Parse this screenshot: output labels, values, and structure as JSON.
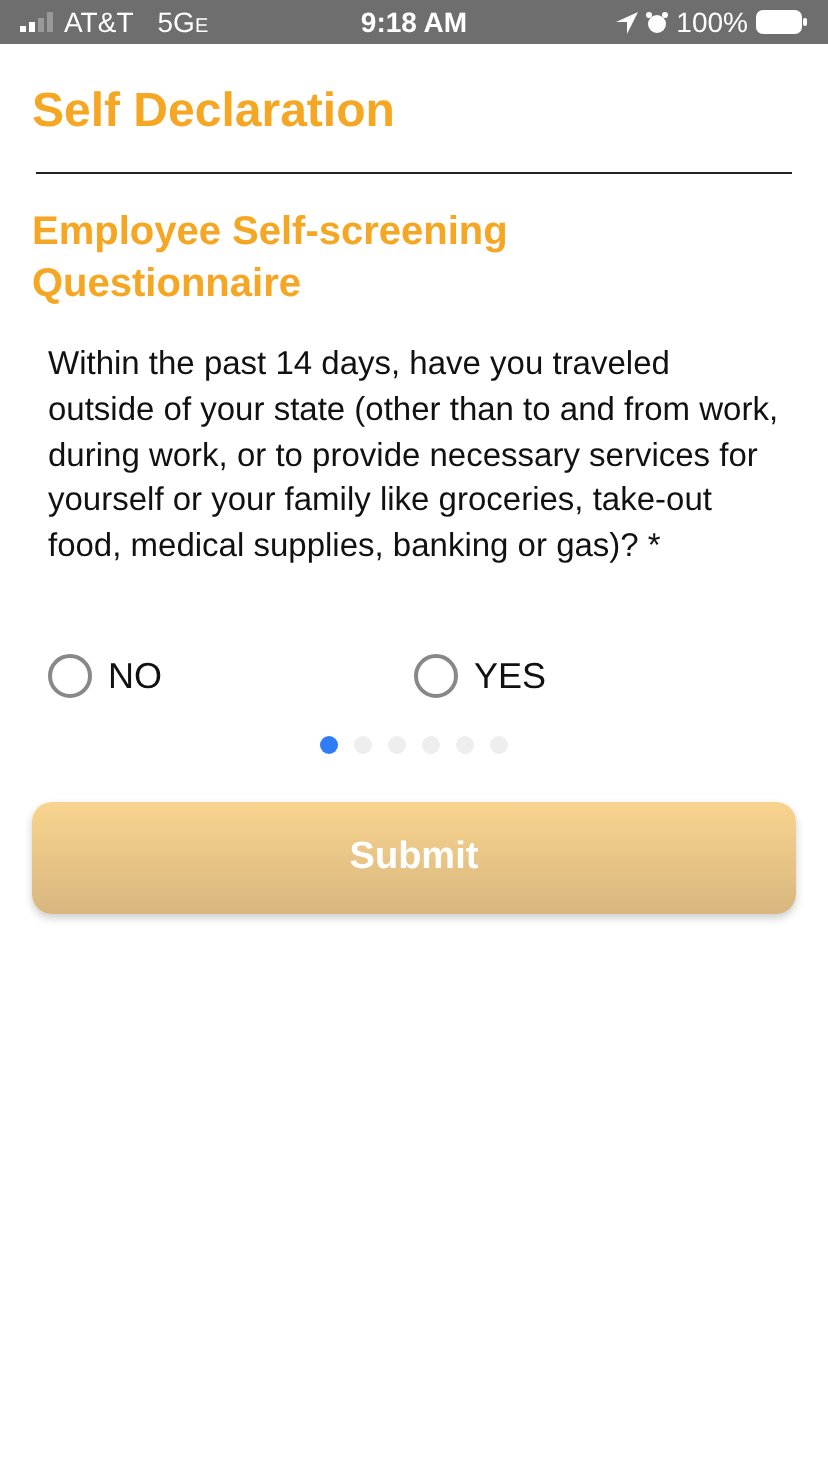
{
  "status_bar": {
    "carrier": "AT&T",
    "network": "5G",
    "network_suffix": "E",
    "time": "9:18 AM",
    "battery": "100%"
  },
  "title": "Self Declaration",
  "subtitle": "Employee Self-screening Questionnaire",
  "question": "Within the past 14 days, have you traveled outside of your state (other than to and from work, during work, or to provide necessary services for yourself or your family like groceries, take-out food, medical supplies, banking or gas)? *",
  "options": [
    {
      "label": "NO",
      "selected": false
    },
    {
      "label": "YES",
      "selected": false
    }
  ],
  "pages": [
    {
      "selected": true
    },
    {
      "selected": false
    },
    {
      "selected": false
    },
    {
      "selected": false
    },
    {
      "selected": false
    },
    {
      "selected": false
    }
  ],
  "submit": {
    "label": "Submit",
    "disabled": true
  }
}
